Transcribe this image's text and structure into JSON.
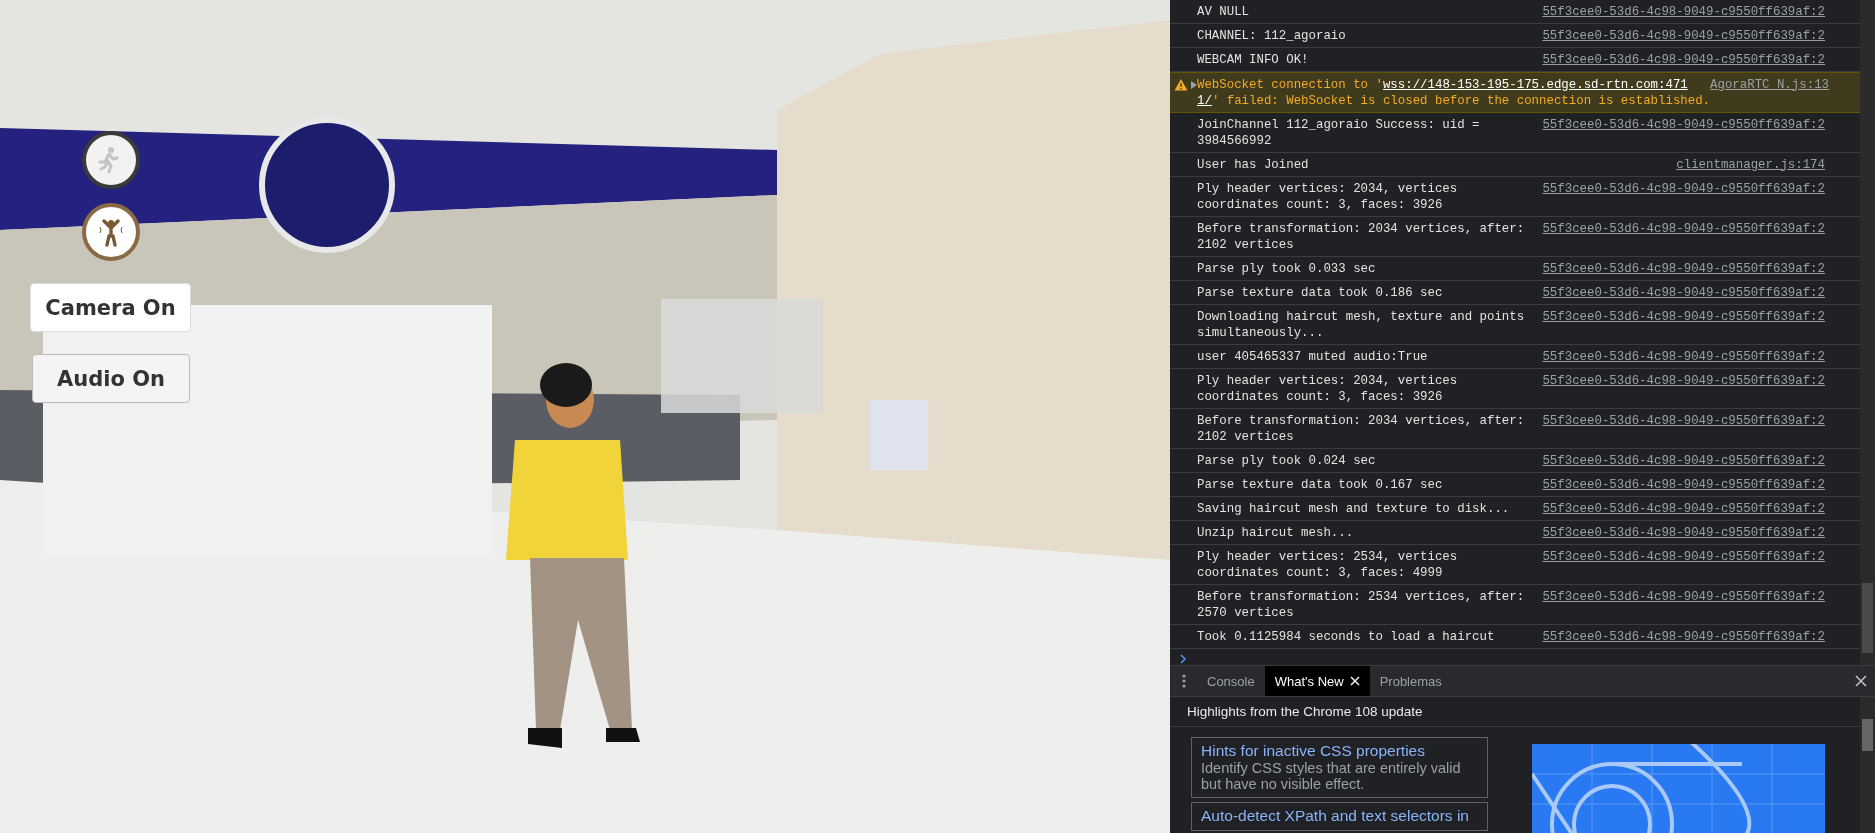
{
  "game_view": {
    "kind": "picture",
    "mode_buttons": [
      {
        "kind": "walk",
        "selected": false
      },
      {
        "kind": "dance",
        "selected": true
      }
    ],
    "media_buttons": [
      {
        "label": "Camera On"
      },
      {
        "label": "Audio On"
      }
    ]
  },
  "console": {
    "messages": [
      {
        "kind": "log",
        "text": "AV NULL",
        "source": "55f3cee0-53d6-4c98-9049-c9550ff639af:2"
      },
      {
        "kind": "log",
        "text": "CHANNEL: 112_agoraio",
        "source": "55f3cee0-53d6-4c98-9049-c9550ff639af:2"
      },
      {
        "kind": "log",
        "text": "WEBCAM INFO OK!",
        "source": "55f3cee0-53d6-4c98-9049-c9550ff639af:2"
      },
      {
        "kind": "warning",
        "lines": [
          [
            {
              "kind": "text",
              "text": "WebSocket connection to '"
            },
            {
              "kind": "link",
              "text": "wss://148-153-195-175.edge.sd-rtn.com:471"
            }
          ],
          [
            {
              "kind": "link",
              "text": "1/"
            },
            {
              "kind": "text",
              "text": "' failed: WebSocket is closed before the connection is established."
            }
          ]
        ],
        "source": "AgoraRTC_N.js:13"
      },
      {
        "kind": "log",
        "text": "JoinChannel 112_agoraio Success: uid = 3984566992",
        "source": "55f3cee0-53d6-4c98-9049-c9550ff639af:2"
      },
      {
        "kind": "log",
        "text": "User has Joined",
        "source": "clientmanager.js:174"
      },
      {
        "kind": "log",
        "text": "Ply header vertices: 2034, vertices coordinates count: 3, faces: 3926",
        "source": "55f3cee0-53d6-4c98-9049-c9550ff639af:2"
      },
      {
        "kind": "log",
        "text": "Before transformation: 2034 vertices, after: 2102 vertices",
        "source": "55f3cee0-53d6-4c98-9049-c9550ff639af:2"
      },
      {
        "kind": "log",
        "text": "Parse ply took 0.033 sec",
        "source": "55f3cee0-53d6-4c98-9049-c9550ff639af:2"
      },
      {
        "kind": "log",
        "text": "Parse texture data took 0.186 sec",
        "source": "55f3cee0-53d6-4c98-9049-c9550ff639af:2"
      },
      {
        "kind": "log",
        "text": "Downloading haircut mesh, texture and points simultaneously...",
        "source": "55f3cee0-53d6-4c98-9049-c9550ff639af:2"
      },
      {
        "kind": "log",
        "text": "user 405465337 muted audio:True",
        "source": "55f3cee0-53d6-4c98-9049-c9550ff639af:2"
      },
      {
        "kind": "log",
        "text": "Ply header vertices: 2034, vertices coordinates count: 3, faces: 3926",
        "source": "55f3cee0-53d6-4c98-9049-c9550ff639af:2"
      },
      {
        "kind": "log",
        "text": "Before transformation: 2034 vertices, after: 2102 vertices",
        "source": "55f3cee0-53d6-4c98-9049-c9550ff639af:2"
      },
      {
        "kind": "log",
        "text": "Parse ply took 0.024 sec",
        "source": "55f3cee0-53d6-4c98-9049-c9550ff639af:2"
      },
      {
        "kind": "log",
        "text": "Parse texture data took 0.167 sec",
        "source": "55f3cee0-53d6-4c98-9049-c9550ff639af:2"
      },
      {
        "kind": "log",
        "text": "Saving haircut mesh and texture to disk...",
        "source": "55f3cee0-53d6-4c98-9049-c9550ff639af:2"
      },
      {
        "kind": "log",
        "text": "Unzip haircut mesh...",
        "source": "55f3cee0-53d6-4c98-9049-c9550ff639af:2"
      },
      {
        "kind": "log",
        "text": "Ply header vertices: 2534, vertices coordinates count: 3, faces: 4999",
        "source": "55f3cee0-53d6-4c98-9049-c9550ff639af:2"
      },
      {
        "kind": "log",
        "text": "Before transformation: 2534 vertices, after: 2570 vertices",
        "source": "55f3cee0-53d6-4c98-9049-c9550ff639af:2"
      },
      {
        "kind": "log",
        "text": "Took 0.1125984 seconds to load a haircut",
        "source": "55f3cee0-53d6-4c98-9049-c9550ff639af:2"
      }
    ]
  },
  "drawer": {
    "tabs": [
      {
        "label": "Console",
        "selected": false,
        "closable": false
      },
      {
        "label": "What's New",
        "selected": true,
        "closable": true
      },
      {
        "label": "Problemas",
        "selected": false,
        "closable": false
      }
    ],
    "header": "Highlights from the Chrome 108 update",
    "features": [
      {
        "title": "Hints for inactive CSS properties",
        "description": "Identify CSS styles that are entirely valid but have no visible effect."
      },
      {
        "title": "Auto-detect XPath and text selectors in"
      }
    ]
  }
}
